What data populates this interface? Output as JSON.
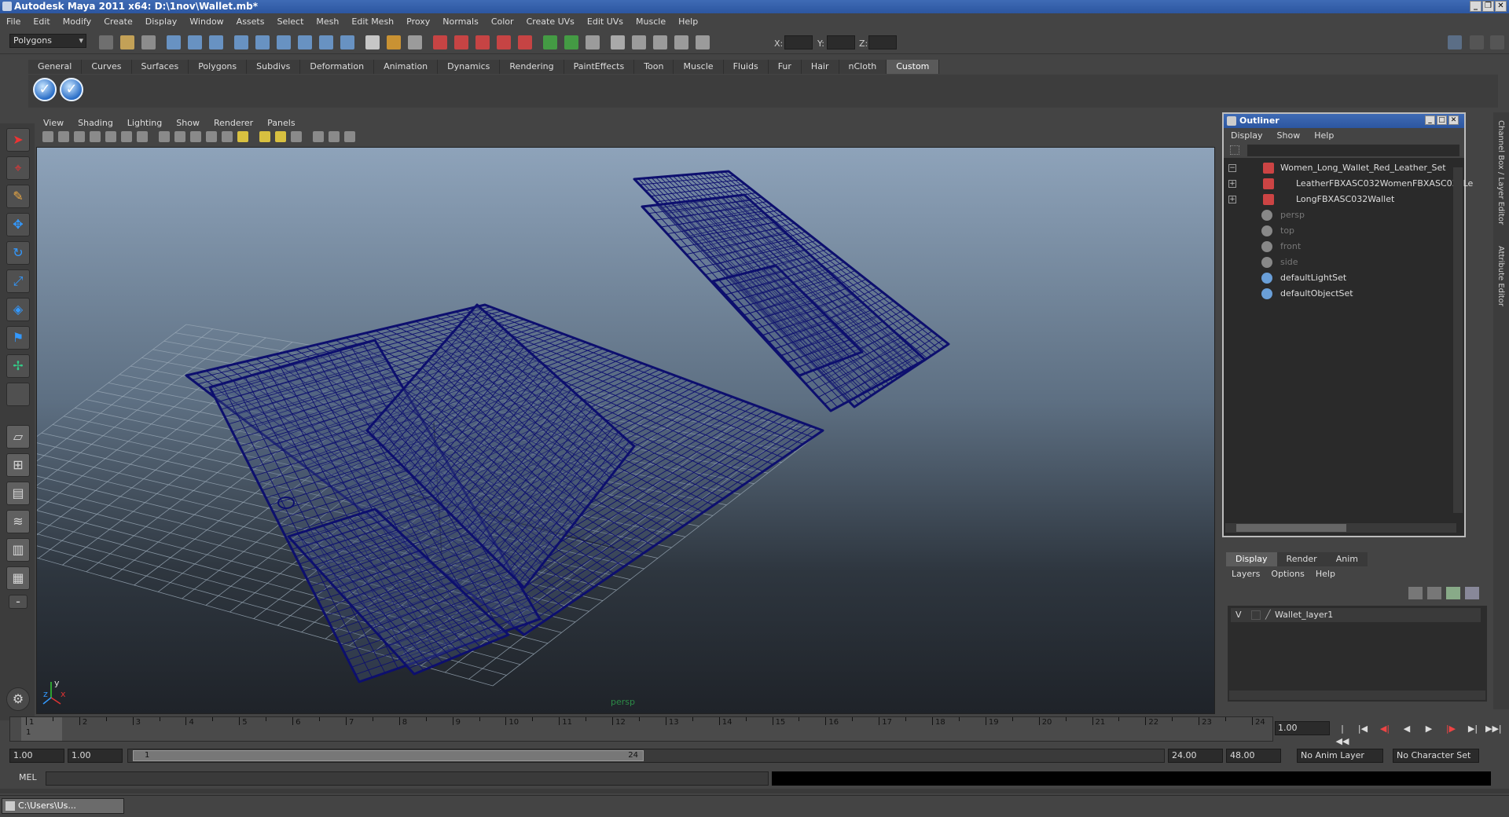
{
  "window": {
    "title": "Autodesk Maya 2011 x64: D:\\1nov\\Wallet.mb*"
  },
  "menubar": [
    "File",
    "Edit",
    "Modify",
    "Create",
    "Display",
    "Window",
    "Assets",
    "Select",
    "Mesh",
    "Edit Mesh",
    "Proxy",
    "Normals",
    "Color",
    "Create UVs",
    "Edit UVs",
    "Muscle",
    "Help"
  ],
  "statusline": {
    "menuset": "Polygons",
    "x_label": "X:",
    "y_label": "Y:",
    "z_label": "Z:"
  },
  "shelf": {
    "tabs": [
      "General",
      "Curves",
      "Surfaces",
      "Polygons",
      "Subdivs",
      "Deformation",
      "Animation",
      "Dynamics",
      "Rendering",
      "PaintEffects",
      "Toon",
      "Muscle",
      "Fluids",
      "Fur",
      "Hair",
      "nCloth",
      "Custom"
    ],
    "active_tab": "Custom"
  },
  "viewport": {
    "menu": [
      "View",
      "Shading",
      "Lighting",
      "Show",
      "Renderer",
      "Panels"
    ],
    "camera_label": "persp",
    "axis_y": "y",
    "axis_x": "x",
    "axis_z": "z",
    "wire_color": "#0d0f6e"
  },
  "outliner": {
    "title": "Outliner",
    "menu": [
      "Display",
      "Show",
      "Help"
    ],
    "items": [
      {
        "label": "Women_Long_Wallet_Red_Leather_Set",
        "dim": false
      },
      {
        "label": "LeatherFBXASC032WomenFBXASC032Le",
        "dim": false
      },
      {
        "label": "LongFBXASC032Wallet",
        "dim": false
      },
      {
        "label": "persp",
        "dim": true
      },
      {
        "label": "top",
        "dim": true
      },
      {
        "label": "front",
        "dim": true
      },
      {
        "label": "side",
        "dim": true
      },
      {
        "label": "defaultLightSet",
        "dim": false
      },
      {
        "label": "defaultObjectSet",
        "dim": false
      }
    ]
  },
  "layer_editor": {
    "tabs": [
      "Display",
      "Render",
      "Anim"
    ],
    "menu": [
      "Layers",
      "Options",
      "Help"
    ],
    "layer": {
      "visible": "V",
      "name": "Wallet_layer1"
    }
  },
  "side_tabs": [
    "Channel Box / Layer Editor",
    "Attribute Editor"
  ],
  "timeline": {
    "ticks": [
      "1",
      "2",
      "3",
      "4",
      "5",
      "6",
      "7",
      "8",
      "9",
      "10",
      "11",
      "12",
      "13",
      "14",
      "15",
      "16",
      "17",
      "18",
      "19",
      "20",
      "21",
      "22",
      "23",
      "24"
    ],
    "current_frame_marker": "1",
    "current_frame": "1.00"
  },
  "range": {
    "start": "1.00",
    "playback_start": "1.00",
    "slider_start": "1",
    "slider_end": "24",
    "playback_end": "24.00",
    "end": "48.00",
    "anim_layer": "No Anim Layer",
    "character_set": "No Character Set"
  },
  "cmdline": {
    "label": "MEL"
  },
  "taskbar": {
    "item": "C:\\Users\\Us..."
  }
}
